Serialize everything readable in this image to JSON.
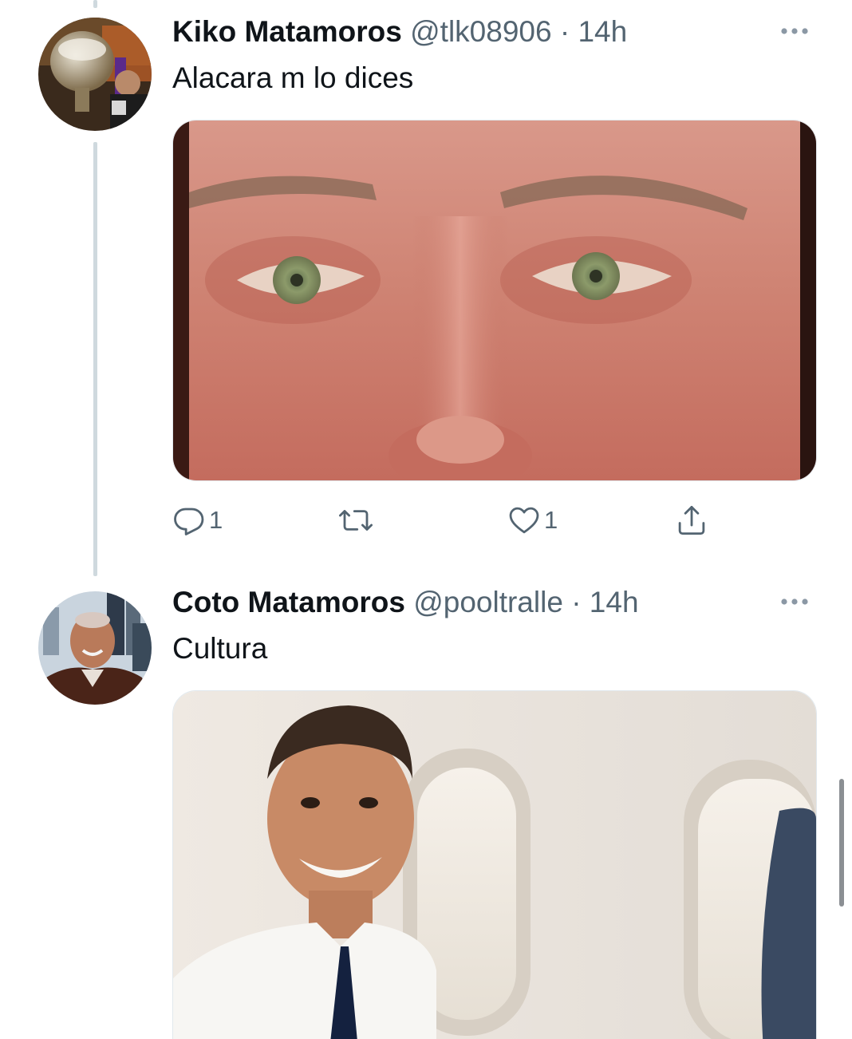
{
  "tweets": [
    {
      "display_name": "Kiko Matamoros",
      "handle": "@tlk08906",
      "separator": "·",
      "time": "14h",
      "text": "Alacara m lo dices",
      "reply_count": "1",
      "retweet_count": "",
      "like_count": "1",
      "icons": [
        "reply-icon",
        "retweet-icon",
        "like-icon",
        "share-icon",
        "more-icon"
      ]
    },
    {
      "display_name": "Coto Matamoros",
      "handle": "@pooltralle",
      "separator": "·",
      "time": "14h",
      "text": "Cultura"
    }
  ],
  "colors": {
    "text_primary": "#0f1419",
    "text_secondary": "#536471",
    "thread_line": "#cfd9de",
    "background": "#ffffff"
  }
}
